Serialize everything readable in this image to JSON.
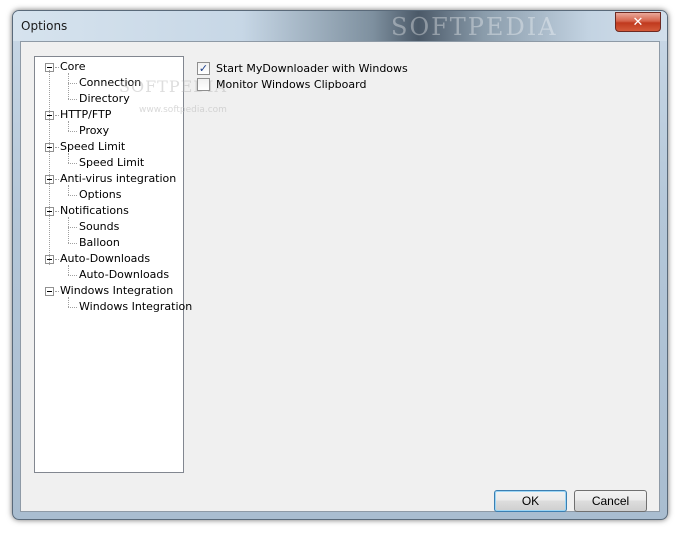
{
  "window": {
    "title": "Options",
    "watermark": "SOFTPEDIA",
    "close_glyph": "✕"
  },
  "tree": {
    "items": [
      {
        "label": "Core",
        "children": [
          "Connection",
          "Directory"
        ]
      },
      {
        "label": "HTTP/FTP",
        "children": [
          "Proxy"
        ]
      },
      {
        "label": "Speed Limit",
        "children": [
          "Speed Limit"
        ]
      },
      {
        "label": "Anti-virus integration",
        "children": [
          "Options"
        ]
      },
      {
        "label": "Notifications",
        "children": [
          "Sounds",
          "Balloon"
        ]
      },
      {
        "label": "Auto-Downloads",
        "children": [
          "Auto-Downloads"
        ]
      },
      {
        "label": "Windows Integration",
        "children": [
          "Windows Integration"
        ]
      }
    ]
  },
  "options": {
    "start_with_windows": {
      "label": "Start MyDownloader with Windows",
      "checked": true
    },
    "monitor_clipboard": {
      "label": "Monitor Windows Clipboard",
      "checked": false
    }
  },
  "watermark_mid": "SOFTPEDIA",
  "watermark_url": "www.softpedia.com",
  "buttons": {
    "ok": "OK",
    "cancel": "Cancel"
  },
  "icons": {
    "check": "checkmark-icon",
    "close": "close-icon",
    "expander": "minus-icon"
  }
}
